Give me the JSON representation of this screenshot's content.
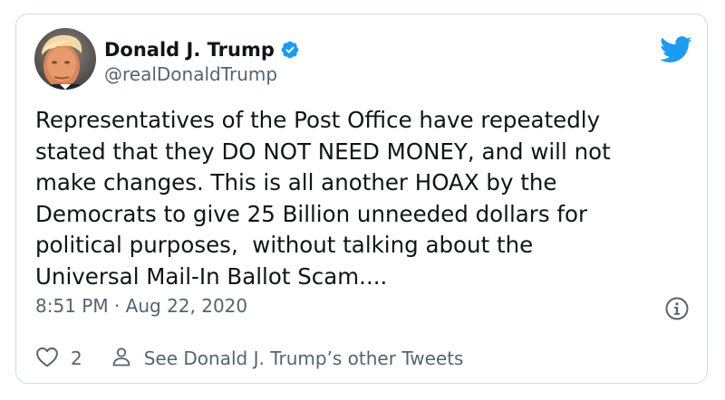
{
  "tweet": {
    "author": {
      "display_name": "Donald J. Trump",
      "handle": "@realDonaldTrump",
      "verified": true
    },
    "text": "Representatives of the Post Office have repeatedly\nstated that they DO NOT NEED MONEY, and will not\nmake changes. This is all another HOAX by the\nDemocrats to give 25 Billion unneeded dollars for\npolitical purposes,  without talking about the\nUniversal Mail-In Ballot Scam....",
    "timestamp": "8:51 PM · Aug 22, 2020",
    "like_count": "2",
    "see_other_label": "See Donald J. Trump’s other Tweets"
  },
  "icons": {
    "brand": "twitter-bird-icon",
    "verified": "verified-badge-icon",
    "info": "info-icon",
    "like": "heart-icon",
    "profile": "person-icon"
  },
  "colors": {
    "brand_blue": "#1d9bf0",
    "text_primary": "#0f1419",
    "text_secondary": "#536471",
    "border": "#cfd9de"
  }
}
